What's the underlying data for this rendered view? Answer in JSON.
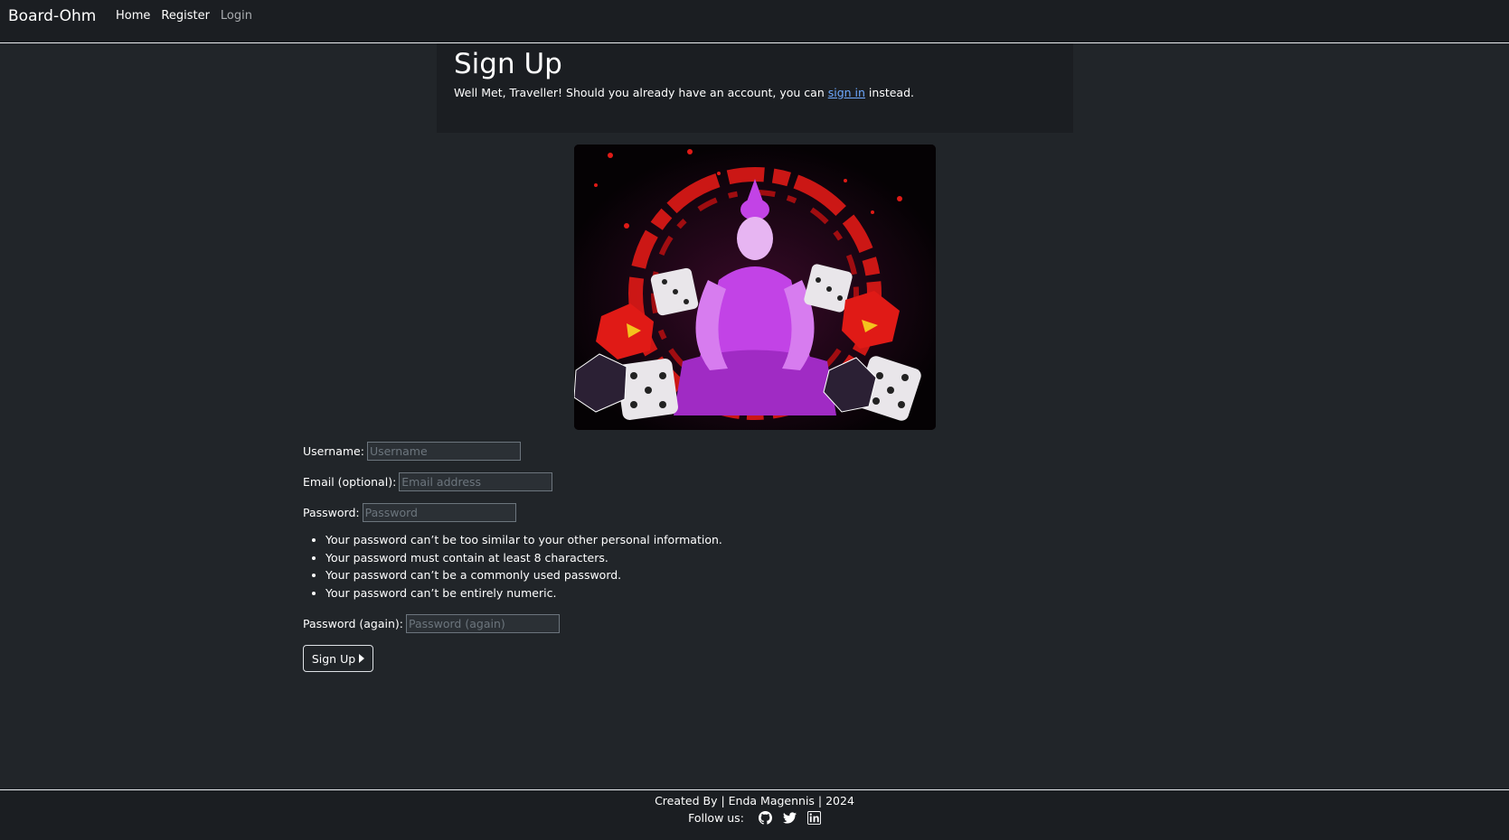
{
  "nav": {
    "brand": "Board-Ohm",
    "links": [
      {
        "label": "Home"
      },
      {
        "label": "Register"
      },
      {
        "label": "Login"
      }
    ]
  },
  "header": {
    "title": "Sign Up",
    "lead_before": "Well Met, Traveller! Should you already have an account, you can ",
    "lead_link": "sign in",
    "lead_after": " instead."
  },
  "hero": {
    "icon": "meditating-figure-with-dice-icon"
  },
  "form": {
    "username_label": "Username:",
    "username_placeholder": "Username",
    "email_label": "Email (optional):",
    "email_placeholder": "Email address",
    "password_label": "Password:",
    "password_placeholder": "Password",
    "password_help": [
      "Your password can’t be too similar to your other personal information.",
      "Your password must contain at least 8 characters.",
      "Your password can’t be a commonly used password.",
      "Your password can’t be entirely numeric."
    ],
    "password2_label": "Password (again):",
    "password2_placeholder": "Password (again)",
    "submit_label": "Sign Up",
    "submit_icon": "caret-right-icon"
  },
  "footer": {
    "credits": "Created By | Enda Magennis | 2024",
    "follow_label": "Follow us:",
    "social_icons": [
      "github-icon",
      "twitter-icon",
      "linkedin-icon"
    ]
  },
  "colors": {
    "background": "#212529",
    "panel": "#1b1e22",
    "link": "#6ea8fe",
    "dice_red": "#e01a16",
    "figure_purple": "#c243e6"
  }
}
